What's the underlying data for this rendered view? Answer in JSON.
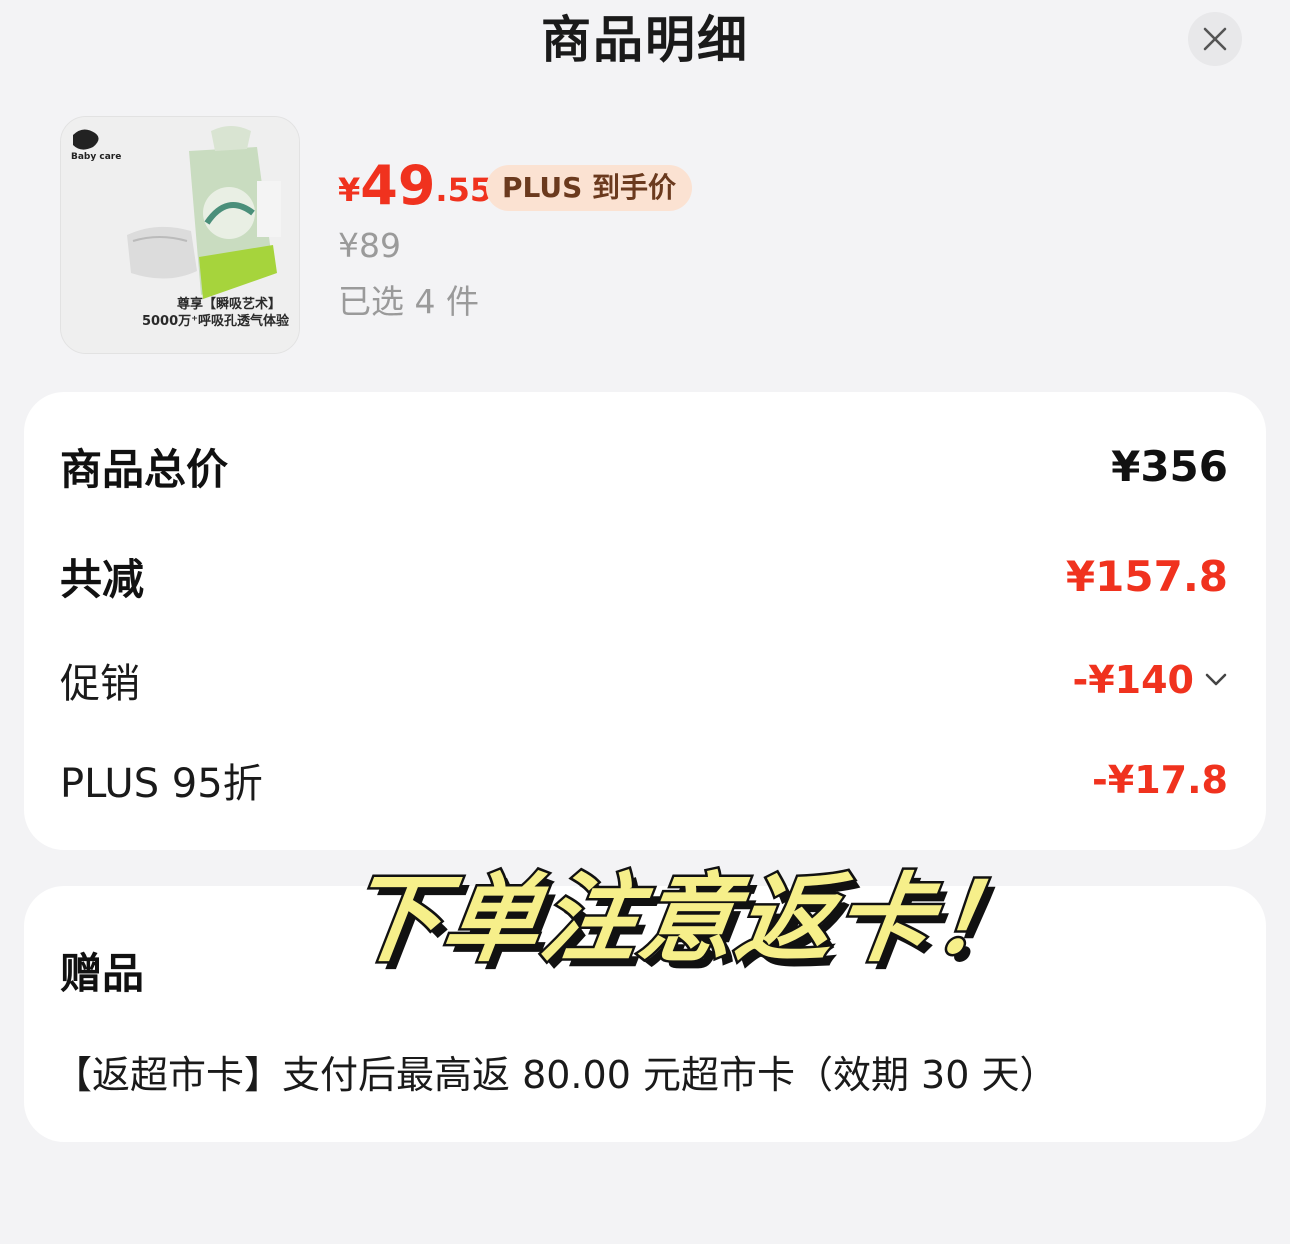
{
  "header": {
    "title": "商品明细",
    "close_icon": "close-icon"
  },
  "product": {
    "image_brand": "Baby care",
    "image_caption_1": "尊享【瞬吸艺术】",
    "image_caption_2": "5000万⁺呼吸孔透气体验",
    "price_symbol": "¥",
    "price_integer": "49",
    "price_decimal": ".55",
    "plus_badge": "PLUS 到手价",
    "original_price": "¥89",
    "selected_count": "已选 4 件"
  },
  "summary": {
    "total_label": "商品总价",
    "total_value": "¥356",
    "discount_label": "共减",
    "discount_value": "¥157.8",
    "promo_label": "促销",
    "promo_value": "-¥140",
    "plus_label": "PLUS 95折",
    "plus_value": "-¥17.8"
  },
  "gift": {
    "title": "赠品",
    "text": "【返超市卡】支付后最高返 80.00 元超市卡（效期 30 天）"
  },
  "overlay": {
    "text": "下单注意返卡！"
  },
  "colors": {
    "accent_red": "#f0321e",
    "plus_badge_bg": "#fbe2d2",
    "page_bg": "#f3f3f5"
  }
}
